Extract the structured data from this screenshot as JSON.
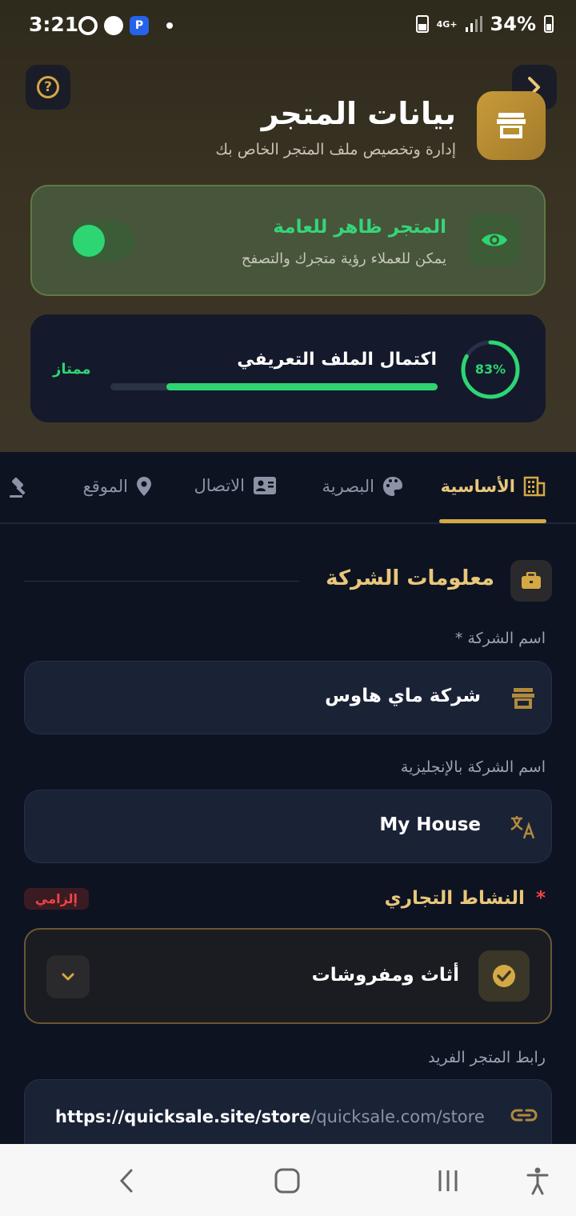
{
  "status_bar": {
    "time": "3:21",
    "network": "4G+",
    "battery": "34%"
  },
  "header": {
    "title": "بيانات المتجر",
    "subtitle": "إدارة وتخصيص ملف المتجر الخاص بك",
    "help_icon": "question-circle-icon",
    "back_icon": "chevron-right-icon",
    "store_icon": "store-icon"
  },
  "visibility": {
    "title": "المتجر ظاهر للعامة",
    "subtitle": "يمكن للعملاء رؤية متجرك والتصفح",
    "enabled": true,
    "icon": "eye-icon"
  },
  "completion": {
    "title": "اكتمال الملف التعريفي",
    "percent_label": "83%",
    "percent": 83,
    "progress_fraction": 0.83,
    "status": "ممتاز"
  },
  "tabs": [
    {
      "label": "الأساسية",
      "icon": "building-icon",
      "active": true
    },
    {
      "label": "البصرية",
      "icon": "palette-icon",
      "active": false
    },
    {
      "label": "الاتصال",
      "icon": "contact-card-icon",
      "active": false
    },
    {
      "label": "الموقع",
      "icon": "map-pin-icon",
      "active": false
    },
    {
      "label": "",
      "icon": "gavel-icon",
      "active": false
    }
  ],
  "section": {
    "title": "معلومات الشركة",
    "icon": "briefcase-icon"
  },
  "fields": {
    "company_name": {
      "label": "اسم الشركة *",
      "value": "شركة ماي هاوس",
      "icon": "store-icon"
    },
    "company_name_en": {
      "label": "اسم الشركة بالإنجليزية",
      "value": "My House",
      "icon": "translate-icon"
    }
  },
  "activity": {
    "label": "النشاط التجاري",
    "required_mark": "*",
    "required_badge": "إلزامي",
    "value": "أثاث ومفروشات",
    "icon": "check-circle-icon"
  },
  "store_url": {
    "label": "رابط المتجر الفريد",
    "prefix": "https://quicksale.site/store",
    "placeholder": "/quicksale.com/store",
    "icon": "link-icon"
  },
  "colors": {
    "gold": "#d4a843",
    "green": "#2ed573",
    "bg": "#0e1322",
    "card": "#1a2235"
  }
}
